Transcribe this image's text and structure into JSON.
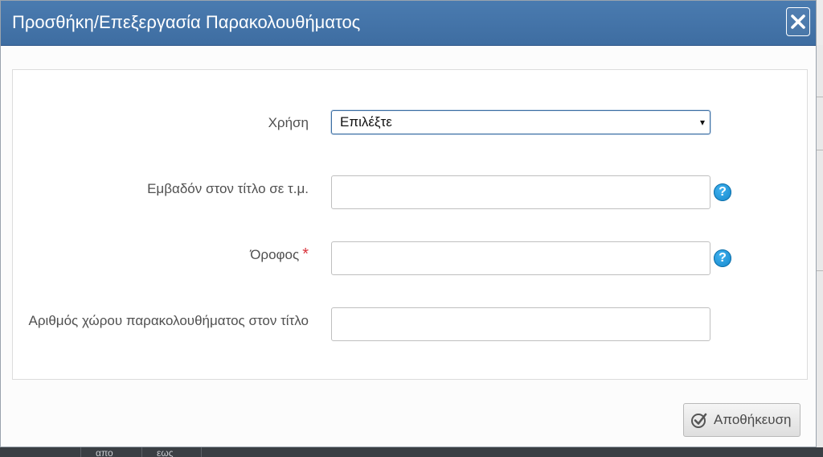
{
  "dialog": {
    "title": "Προσθήκη/Επεξεργασία Παρακολουθήματος",
    "close_icon": "close-icon"
  },
  "form": {
    "use": {
      "label": "Χρήση",
      "selected_value": "Επιλέξτε",
      "caret": "▾"
    },
    "area": {
      "label": "Εμβαδόν στον τίτλο σε τ.μ.",
      "value": "",
      "help_icon": "?"
    },
    "floor": {
      "label": "Όροφος",
      "required_mark": "*",
      "value": "",
      "help_icon": "?"
    },
    "space_number": {
      "label": "Αριθμός χώρου παρακολουθήματος στον τίτλο",
      "value": ""
    }
  },
  "footer": {
    "save_label": "Αποθήκευση",
    "save_icon": "check-circle-icon"
  },
  "background": {
    "table_headers": [
      "απο",
      "εως"
    ]
  },
  "colors": {
    "header_bg": "#3e6da1",
    "help_icon": "#1a8fd6",
    "required_star": "#d9353e"
  }
}
